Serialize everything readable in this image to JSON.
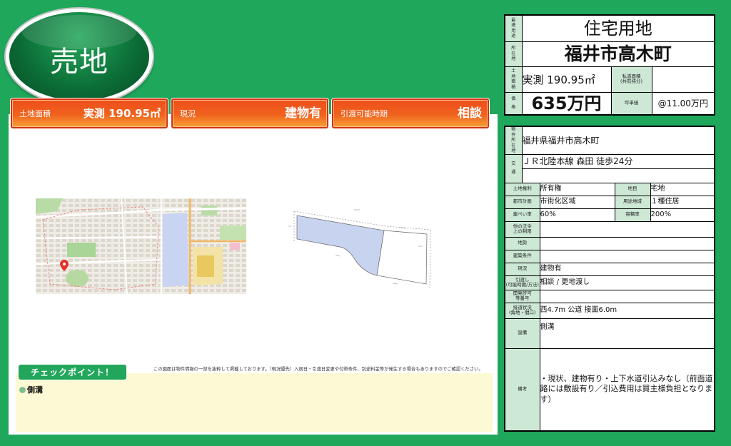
{
  "colors": {
    "page_background": "#1fa75b",
    "label_background": "#cde9d6",
    "summary_orange": "#f0621d",
    "checkpoint_background": "#fdf9d4"
  },
  "title_badge": "売地",
  "summary_boxes": [
    {
      "label": "土地面積",
      "value": "実測 190.95㎡"
    },
    {
      "label": "現況",
      "value": "建物有"
    },
    {
      "label": "引渡可能時期",
      "value": "相談"
    }
  ],
  "overview": {
    "use_label": "最適用途",
    "use_value": "住宅用地",
    "location_label": "所在地",
    "location_value": "福井市高木町",
    "area_label": "土地面積",
    "area_value": "実測 190.95㎡",
    "private_road_label": "私道面積\n(共有持分)",
    "private_road_value": "",
    "price_label": "価格",
    "price_value": "635万円",
    "tsubo_label": "坪単価",
    "tsubo_value": "@11.00万円"
  },
  "details": {
    "address": {
      "label": "物件所在地",
      "value": "福井県福井市高木町"
    },
    "access": {
      "label": "交通",
      "line1": "ＪＲ北陸本線 森田 徒歩24分",
      "line2": ""
    },
    "land_right": {
      "label": "土地権利",
      "value": "所有権"
    },
    "land_category": {
      "label": "地目",
      "value": "宅地"
    },
    "city_planning": {
      "label": "都市計画",
      "value": "市街化区域"
    },
    "zoning": {
      "label": "用途地域",
      "value": "１種住居"
    },
    "coverage": {
      "label": "建ぺい率",
      "value": "60%"
    },
    "floor_area_ratio": {
      "label": "容積率",
      "value": "200%"
    },
    "other_laws": {
      "label": "他の法令\n上の制限",
      "value": ""
    },
    "terrain": {
      "label": "地勢",
      "value": ""
    },
    "building_conditions": {
      "label": "建築条件",
      "value": ""
    },
    "current_status": {
      "label": "現況",
      "value": "建物有"
    },
    "delivery": {
      "label": "引渡し\n(可能時期/方法)",
      "value": "相談 / 更地渡し"
    },
    "dev_permit": {
      "label": "開発許可\n等番号",
      "value": ""
    },
    "road_access": {
      "label": "接道状況\n(角地・間口)",
      "value": "西4.7m 公道 接面6.0m"
    },
    "facilities": {
      "label": "設備",
      "value": "側溝"
    },
    "remarks": {
      "label": "備考",
      "value": "・現状、建物有り・上下水道引込みなし（前面道路には敷設有り／引込費用は買主様負担となります）"
    }
  },
  "disclaimer": "この図面は物件情報の一部を抜粋して掲載しております。（現況優先）入居日・引渡日変更や付帯条件、別途料金等が発生する場合もありますのでご確認ください。",
  "checkpoint": {
    "title": "チェックポイント！",
    "items": [
      "側溝"
    ]
  }
}
